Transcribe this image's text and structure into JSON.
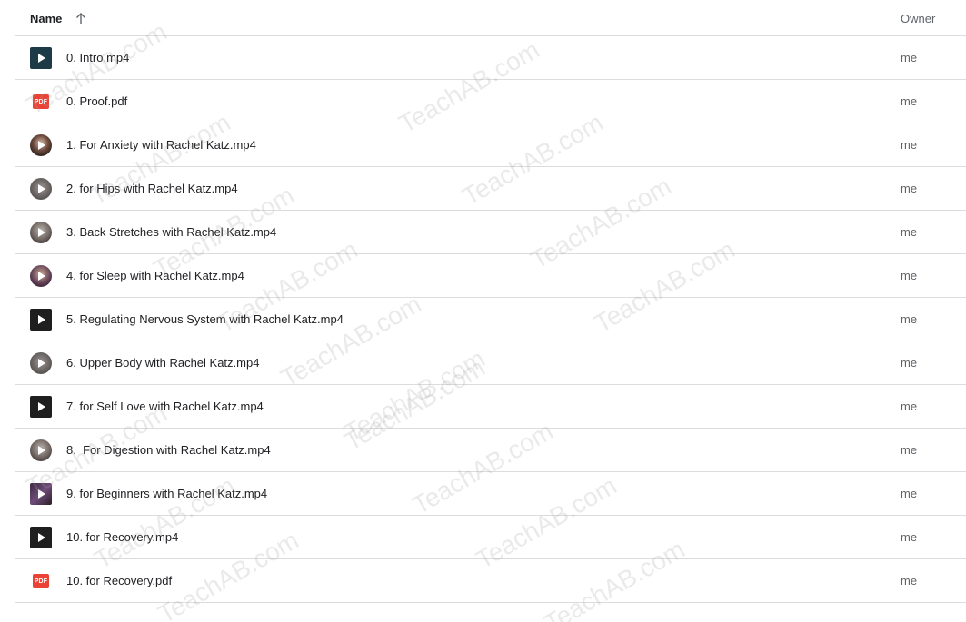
{
  "header": {
    "name_label": "Name",
    "owner_label": "Owner",
    "sort_icon": "arrow-up-icon"
  },
  "files": [
    {
      "name": "0. Intro.mp4",
      "owner": "me",
      "icon": "video-thumbnail-icon",
      "thumb": "teal"
    },
    {
      "name": "0. Proof.pdf",
      "owner": "me",
      "icon": "pdf-icon",
      "thumb": "pdf"
    },
    {
      "name": "1. For Anxiety with Rachel Katz.mp4",
      "owner": "me",
      "icon": "video-thumbnail-icon",
      "thumb": "person"
    },
    {
      "name": "2. for Hips with Rachel Katz.mp4",
      "owner": "me",
      "icon": "video-thumbnail-icon",
      "thumb": "grey-round"
    },
    {
      "name": "3. Back Stretches with Rachel Katz.mp4",
      "owner": "me",
      "icon": "video-thumbnail-icon",
      "thumb": "person2"
    },
    {
      "name": "4. for Sleep with Rachel Katz.mp4",
      "owner": "me",
      "icon": "video-thumbnail-icon",
      "thumb": "person3"
    },
    {
      "name": "5. Regulating Nervous System with Rachel Katz.mp4",
      "owner": "me",
      "icon": "video-thumbnail-icon",
      "thumb": "dark"
    },
    {
      "name": "6. Upper Body with Rachel Katz.mp4",
      "owner": "me",
      "icon": "video-thumbnail-icon",
      "thumb": "grey-round"
    },
    {
      "name": "7. for Self Love with Rachel Katz.mp4",
      "owner": "me",
      "icon": "video-thumbnail-icon",
      "thumb": "dark"
    },
    {
      "name": "8.  For Digestion with Rachel Katz.mp4",
      "owner": "me",
      "icon": "video-thumbnail-icon",
      "thumb": "person2"
    },
    {
      "name": "9. for Beginners with Rachel Katz.mp4",
      "owner": "me",
      "icon": "video-thumbnail-icon",
      "thumb": "beginner"
    },
    {
      "name": "10. for Recovery.mp4",
      "owner": "me",
      "icon": "video-thumbnail-icon",
      "thumb": "dark"
    },
    {
      "name": "10. for Recovery.pdf",
      "owner": "me",
      "icon": "pdf-icon",
      "thumb": "pdf"
    }
  ],
  "pdf_badge_text": "PDF",
  "watermark_text": "TeachAB.com",
  "colors": {
    "pdf_red": "#ea4335",
    "divider": "#dadce0",
    "text_primary": "#202124",
    "text_secondary": "#5f6368"
  }
}
